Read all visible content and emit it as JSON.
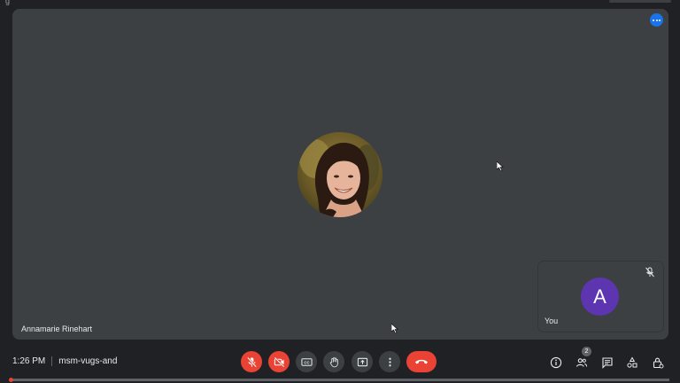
{
  "window": {
    "title_fragment": "g"
  },
  "stage": {
    "participant_name": "Annamarie Rinehart",
    "more_icon": "more-horiz-icon"
  },
  "self_tile": {
    "avatar_letter": "A",
    "label": "You",
    "mic_icon": "mic-off-icon"
  },
  "bottom_bar": {
    "time": "1:26 PM",
    "meeting_code": "msm-vugs-and",
    "participant_count": "2",
    "controls": [
      {
        "icon": "mic-off-icon",
        "state": "off"
      },
      {
        "icon": "videocam-off-icon",
        "state": "off"
      },
      {
        "icon": "closed-captions-icon",
        "state": "off"
      },
      {
        "icon": "raise-hand-icon",
        "state": "off"
      },
      {
        "icon": "present-screen-icon",
        "state": "off"
      },
      {
        "icon": "more-vert-icon",
        "state": "off"
      },
      {
        "icon": "call-end-icon",
        "state": "end"
      }
    ],
    "side_controls": [
      "meeting-info-icon",
      "people-icon",
      "chat-icon",
      "activities-icon",
      "host-controls-icon"
    ]
  },
  "playback": {
    "progress": 0.0
  },
  "colors": {
    "accent_red": "#ea4335",
    "accent_blue": "#1a73e8",
    "self_avatar": "#5e35b1",
    "tile_bg": "#3c4043",
    "bar_bg": "#202124"
  }
}
